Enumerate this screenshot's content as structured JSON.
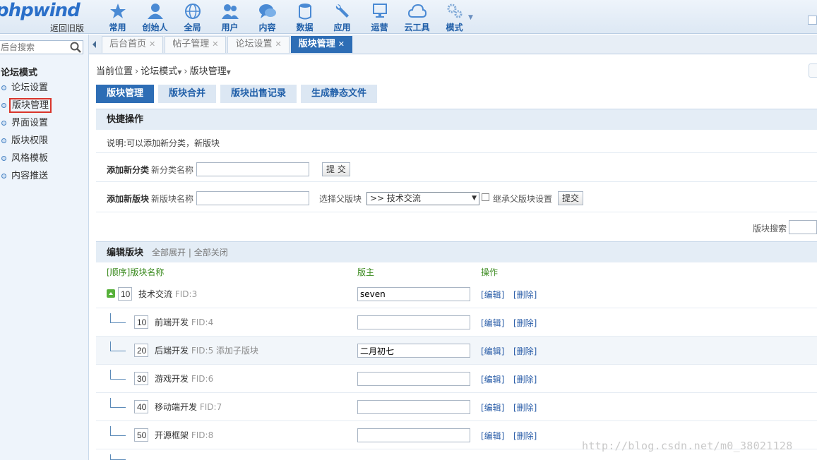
{
  "header": {
    "logo": "phpwind",
    "back_link": "返回旧版",
    "nav": [
      {
        "label": "常用",
        "icon": "star-icon"
      },
      {
        "label": "创始人",
        "icon": "user-icon"
      },
      {
        "label": "全局",
        "icon": "globe-icon"
      },
      {
        "label": "用户",
        "icon": "users-icon"
      },
      {
        "label": "内容",
        "icon": "chat-icon"
      },
      {
        "label": "数据",
        "icon": "database-icon"
      },
      {
        "label": "应用",
        "icon": "wrench-icon"
      },
      {
        "label": "运营",
        "icon": "monitor-icon"
      },
      {
        "label": "云工具",
        "icon": "cloud-icon"
      },
      {
        "label": "模式",
        "icon": "gears-icon"
      }
    ]
  },
  "sidebar": {
    "search_placeholder": "后台搜索",
    "title": "论坛模式",
    "items": [
      {
        "label": "论坛设置"
      },
      {
        "label": "版块管理"
      },
      {
        "label": "界面设置"
      },
      {
        "label": "版块权限"
      },
      {
        "label": "风格模板"
      },
      {
        "label": "内容推送"
      }
    ]
  },
  "tabs": [
    {
      "label": "后台首页"
    },
    {
      "label": "帖子管理"
    },
    {
      "label": "论坛设置"
    },
    {
      "label": "版块管理"
    }
  ],
  "breadcrumb": {
    "prefix": "当前位置",
    "level1": "论坛模式",
    "level2": "版块管理"
  },
  "buttons": {
    "manage": "版块管理",
    "merge": "版块合并",
    "sales": "版块出售记录",
    "static": "生成静态文件"
  },
  "quick": {
    "title": "快捷操作",
    "note": "说明:可以添加新分类，新版块",
    "add_category_label": "添加新分类",
    "category_name_label": "新分类名称",
    "category_name_value": "",
    "submit1": "提 交",
    "add_forum_label": "添加新版块",
    "forum_name_label": "新版块名称",
    "forum_name_value": "",
    "parent_label": "选择父版块",
    "parent_selected": ">> 技术交流",
    "inherit_label": "继承父版块设置",
    "submit2": "提交"
  },
  "forum_search_label": "版块搜索",
  "edit": {
    "title": "编辑版块",
    "expand_all": "全部展开",
    "collapse_all": "全部关闭",
    "col_name": "[顺序]版块名称",
    "col_owner": "版主",
    "col_op": "操作",
    "op_edit": "[编辑]",
    "op_delete": "[删除]",
    "add_sub": "添加子版块",
    "rows": [
      {
        "order": "10",
        "name": "技术交流",
        "fid": "FID:3",
        "owner": "seven"
      },
      {
        "order": "10",
        "name": "前端开发",
        "fid": "FID:4",
        "owner": ""
      },
      {
        "order": "20",
        "name": "后端开发",
        "fid": "FID:5",
        "owner": "二月初七"
      },
      {
        "order": "30",
        "name": "游戏开发",
        "fid": "FID:6",
        "owner": ""
      },
      {
        "order": "40",
        "name": "移动端开发",
        "fid": "FID:7",
        "owner": ""
      },
      {
        "order": "50",
        "name": "开源框架",
        "fid": "FID:8",
        "owner": ""
      }
    ]
  },
  "watermark": "http://blog.csdn.net/m0_38021128"
}
